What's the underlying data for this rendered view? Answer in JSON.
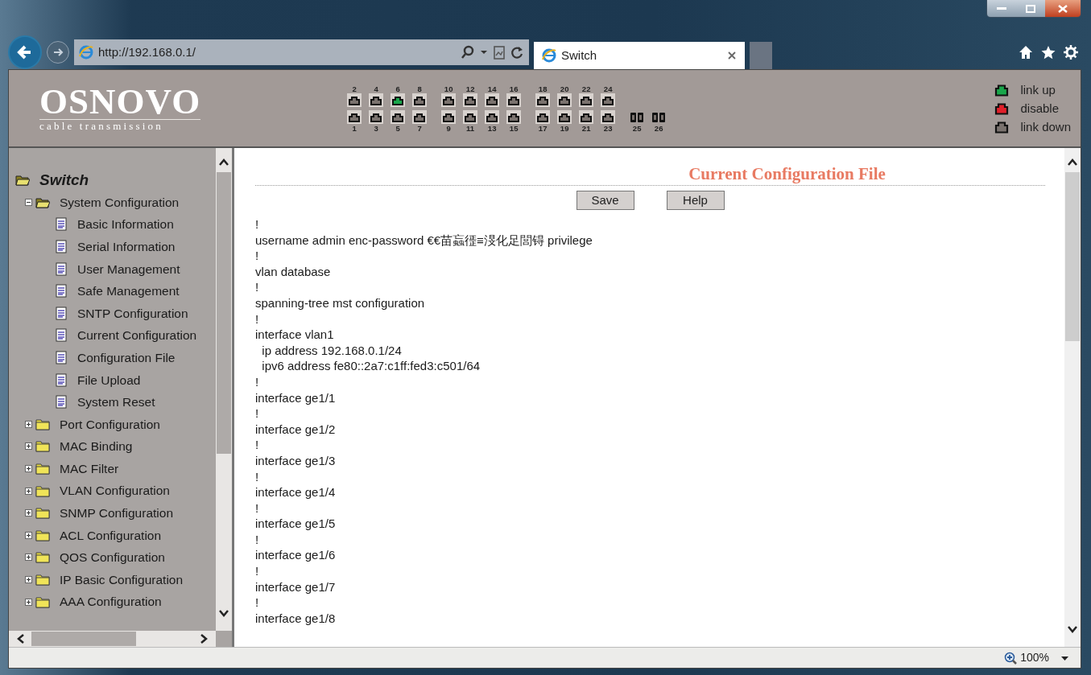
{
  "browser": {
    "address": "http://192.168.0.1/",
    "tab_title": "Switch",
    "zoom": "100%"
  },
  "header": {
    "logo": "OSNOVO",
    "tagline": "cable transmission",
    "port_groups": [
      [
        {
          "top": {
            "label": "2",
            "link_up": false
          },
          "bottom": {
            "label": "1",
            "link_up": false
          }
        },
        {
          "top": {
            "label": "4",
            "link_up": false
          },
          "bottom": {
            "label": "3",
            "link_up": false
          }
        },
        {
          "top": {
            "label": "6",
            "link_up": true
          },
          "bottom": {
            "label": "5",
            "link_up": false
          }
        },
        {
          "top": {
            "label": "8",
            "link_up": false
          },
          "bottom": {
            "label": "7",
            "link_up": false
          }
        }
      ],
      [
        {
          "top": {
            "label": "10",
            "link_up": false
          },
          "bottom": {
            "label": "9",
            "link_up": false
          }
        },
        {
          "top": {
            "label": "12",
            "link_up": false
          },
          "bottom": {
            "label": "11",
            "link_up": false
          }
        },
        {
          "top": {
            "label": "14",
            "link_up": false
          },
          "bottom": {
            "label": "13",
            "link_up": false
          }
        },
        {
          "top": {
            "label": "16",
            "link_up": false
          },
          "bottom": {
            "label": "15",
            "link_up": false
          }
        }
      ],
      [
        {
          "top": {
            "label": "18",
            "link_up": false
          },
          "bottom": {
            "label": "17",
            "link_up": false
          }
        },
        {
          "top": {
            "label": "20",
            "link_up": false
          },
          "bottom": {
            "label": "19",
            "link_up": false
          }
        },
        {
          "top": {
            "label": "22",
            "link_up": false
          },
          "bottom": {
            "label": "21",
            "link_up": false
          }
        },
        {
          "top": {
            "label": "24",
            "link_up": false
          },
          "bottom": {
            "label": "23",
            "link_up": false
          }
        }
      ],
      [
        {
          "bottom": {
            "label": "25",
            "link_up": false,
            "kind": "fiber"
          }
        },
        {
          "bottom": {
            "label": "26",
            "link_up": false,
            "kind": "fiber"
          }
        }
      ]
    ],
    "legend": [
      {
        "label": "link up",
        "color": "#1aa64b"
      },
      {
        "label": "disable",
        "color": "#e0202a"
      },
      {
        "label": "link down",
        "color": "#7a726e"
      }
    ]
  },
  "sidebar": {
    "root": {
      "label": "Switch",
      "expanded": true,
      "children": [
        {
          "label": "System Configuration",
          "kind": "folder",
          "expanded": true,
          "children": [
            {
              "label": "Basic Information",
              "kind": "page"
            },
            {
              "label": "Serial Information",
              "kind": "page"
            },
            {
              "label": "User Management",
              "kind": "page"
            },
            {
              "label": "Safe Management",
              "kind": "page"
            },
            {
              "label": "SNTP Configuration",
              "kind": "page"
            },
            {
              "label": "Current Configuration",
              "kind": "page"
            },
            {
              "label": "Configuration File",
              "kind": "page"
            },
            {
              "label": "File Upload",
              "kind": "page"
            },
            {
              "label": "System Reset",
              "kind": "page"
            }
          ]
        },
        {
          "label": "Port Configuration",
          "kind": "folder",
          "expanded": false
        },
        {
          "label": "MAC Binding",
          "kind": "folder",
          "expanded": false
        },
        {
          "label": "MAC Filter",
          "kind": "folder",
          "expanded": false
        },
        {
          "label": "VLAN Configuration",
          "kind": "folder",
          "expanded": false
        },
        {
          "label": "SNMP Configuration",
          "kind": "folder",
          "expanded": false
        },
        {
          "label": "ACL Configuration",
          "kind": "folder",
          "expanded": false
        },
        {
          "label": "QOS Configuration",
          "kind": "folder",
          "expanded": false
        },
        {
          "label": "IP Basic Configuration",
          "kind": "folder",
          "expanded": false
        },
        {
          "label": "AAA Configuration",
          "kind": "folder",
          "expanded": false
        }
      ]
    }
  },
  "content": {
    "title": "Current Configuration File",
    "buttons": [
      "Save",
      "Help"
    ],
    "config_lines": [
      "!",
      "username admin enc-password €€苗蝱徰≡渂化足閭锝 privilege",
      "!",
      "vlan database",
      "!",
      "spanning-tree mst configuration",
      "!",
      "interface vlan1",
      "  ip address 192.168.0.1/24",
      "  ipv6 address fe80::2a7:c1ff:fed3:c501/64",
      "!",
      "interface ge1/1",
      "!",
      "interface ge1/2",
      "!",
      "interface ge1/3",
      "!",
      "interface ge1/4",
      "!",
      "interface ge1/5",
      "!",
      "interface ge1/6",
      "!",
      "interface ge1/7",
      "!",
      "interface ge1/8"
    ]
  }
}
